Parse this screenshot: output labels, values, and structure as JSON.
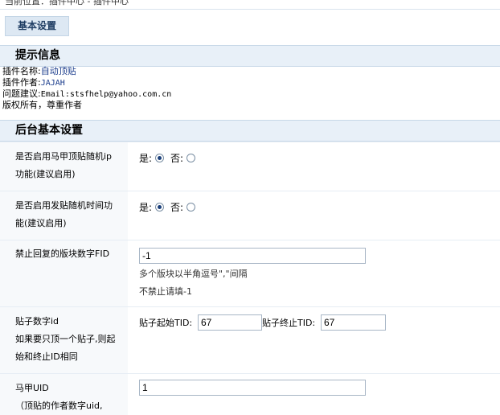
{
  "breadcrumb": "当前位置：插件中心 - 插件中心",
  "tab": {
    "label": "基本设置"
  },
  "section_info": {
    "title": "提示信息",
    "lines": [
      {
        "key": "插件名称:",
        "value": "自动顶贴"
      },
      {
        "key": "插件作者:",
        "value": "JAJAH"
      },
      {
        "key": "问题建议:",
        "value": "Email:stsfhelp@yahoo.com.cn"
      },
      {
        "key": "版权所有，尊重作者",
        "value": ""
      }
    ]
  },
  "section_settings": {
    "title": "后台基本设置",
    "rows": [
      {
        "label_line1": "是否启用马甲顶贴随机ip",
        "label_line2": "功能(建议启用)",
        "yes": "是:",
        "no": "否:",
        "selected": "yes"
      },
      {
        "label_line1": "是否启用发贴随机时间功",
        "label_line2": "能(建议启用)",
        "yes": "是:",
        "no": "否:",
        "selected": "yes"
      },
      {
        "label": "禁止回复的版块数字FID",
        "value": "-1",
        "hint1": "多个版块以半角逗号\",\"间隔",
        "hint2": "不禁止请填-1"
      },
      {
        "label_line1": "贴子数字id",
        "label_line2": "如果要只顶一个贴子,则起",
        "label_line3": "始和终止ID相同",
        "start_label": "贴子起始TID:",
        "start_value": "67",
        "end_label": "贴子终止TID:",
        "end_value": "67"
      },
      {
        "label_line1": "马甲UID",
        "label_line2": "（顶贴的作者数字uid,",
        "value": "1"
      }
    ]
  }
}
